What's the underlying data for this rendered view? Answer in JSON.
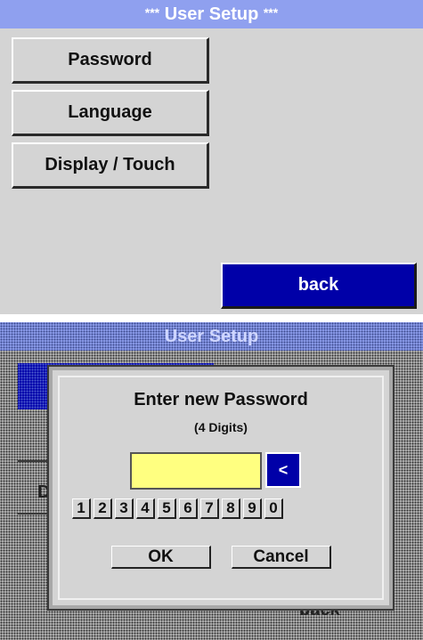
{
  "screen1": {
    "title_prefix": "***",
    "title": "User Setup",
    "title_suffix": "***",
    "menu": [
      {
        "label": "Password"
      },
      {
        "label": "Language"
      },
      {
        "label": "Display / Touch"
      }
    ],
    "back_label": "back"
  },
  "screen2": {
    "background_title": "User Setup",
    "background_back": "back",
    "background_partial_letter": "D",
    "dialog": {
      "title": "Enter new Password",
      "subtitle": "(4 Digits)",
      "password_value": "",
      "backspace_label": "<",
      "digits": [
        "1",
        "2",
        "3",
        "4",
        "5",
        "6",
        "7",
        "8",
        "9",
        "0"
      ],
      "ok_label": "OK",
      "cancel_label": "Cancel"
    }
  },
  "colors": {
    "title_bar": "#8fa0ef",
    "accent_blue": "#0000a8",
    "panel_gray": "#d4d4d4",
    "password_field": "#ffff80"
  }
}
